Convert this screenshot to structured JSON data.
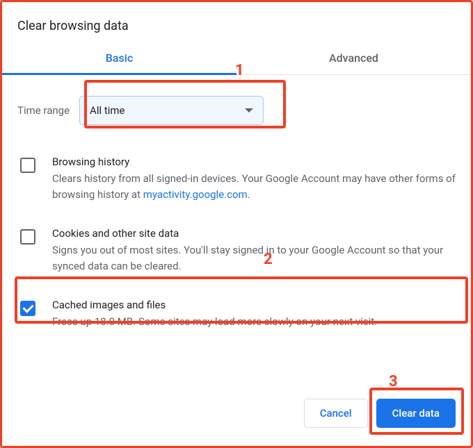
{
  "title": "Clear browsing data",
  "tabs": {
    "basic": "Basic",
    "advanced": "Advanced"
  },
  "time_range": {
    "label": "Time range",
    "value": "All time"
  },
  "items": {
    "browsing_history": {
      "title": "Browsing history",
      "desc_pre": "Clears history from all signed-in devices. Your Google Account may have other forms of browsing history at ",
      "desc_link": "myactivity.google.com",
      "desc_post": "."
    },
    "cookies": {
      "title": "Cookies and other site data",
      "desc": "Signs you out of most sites. You'll stay signed in to your Google Account so that your synced data can be cleared."
    },
    "cache": {
      "title": "Cached images and files",
      "desc": "Frees up 18.0 MB. Some sites may load more slowly on your next visit."
    }
  },
  "buttons": {
    "cancel": "Cancel",
    "clear": "Clear data"
  },
  "annot": {
    "a1": "1",
    "a2": "2",
    "a3": "3"
  }
}
